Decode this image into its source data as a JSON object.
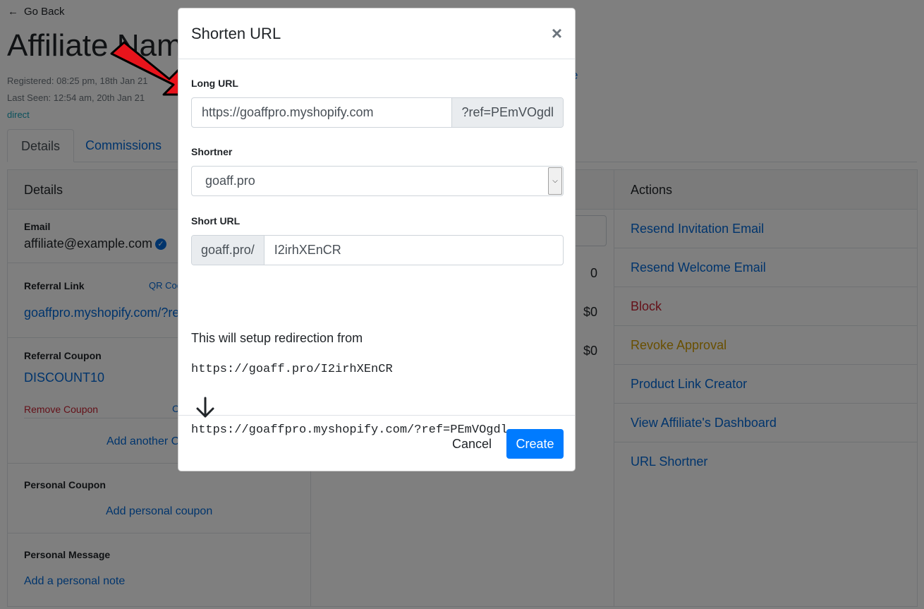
{
  "page": {
    "go_back": "Go Back",
    "title": "Affiliate Name",
    "registered": "Registered: 08:25 pm, 18th Jan 21",
    "last_seen": "Last Seen: 12:54 am, 20th Jan 21",
    "source": "direct",
    "edit_link": "e",
    "tabs": [
      {
        "label": "Details"
      },
      {
        "label": "Commissions"
      }
    ],
    "details_card": {
      "header": "Details",
      "email_label": "Email",
      "email_value": "affiliate@example.com",
      "referral_link_label": "Referral Link",
      "qr_code": "QR Code",
      "referral_link_value": "goaffpro.myshopify.com/?ref=PEmVOgdl",
      "referral_coupon_label": "Referral Coupon",
      "coupon_code": "DISCOUNT10",
      "remove_coupon": "Remove Coupon",
      "copy_label": "C",
      "add_another_coupon": "Add another Coupon",
      "personal_coupon_label": "Personal Coupon",
      "add_personal_coupon": "Add personal coupon",
      "personal_message_label": "Personal Message",
      "add_personal_note": "Add a personal note"
    },
    "stats_card": {
      "values": [
        "0",
        "$0",
        "$0"
      ]
    },
    "actions_card": {
      "header": "Actions",
      "items": [
        {
          "label": "Resend Invitation Email",
          "style": "blue"
        },
        {
          "label": "Resend Welcome Email",
          "style": "blue"
        },
        {
          "label": "Block",
          "style": "danger"
        },
        {
          "label": "Revoke Approval",
          "style": "warning"
        },
        {
          "label": "Product Link Creator",
          "style": "blue"
        },
        {
          "label": "View Affiliate's Dashboard",
          "style": "blue"
        },
        {
          "label": "URL Shortner",
          "style": "blue"
        }
      ]
    }
  },
  "modal": {
    "title": "Shorten URL",
    "close": "×",
    "long_url_label": "Long URL",
    "long_url_value": "https://goaffpro.myshopify.com",
    "long_url_suffix": "?ref=PEmVOgdl",
    "shortener_label": "Shortner",
    "shortener_value": "goaff.pro",
    "short_url_label": "Short URL",
    "short_url_prefix": "goaff.pro/",
    "short_url_value": "I2irhXEnCR",
    "info_text": "This will setup redirection from",
    "from_url": "https://goaff.pro/I2irhXEnCR",
    "to_url": "https://goaffpro.myshopify.com/?ref=PEmVOgdl",
    "cancel_label": "Cancel",
    "create_label": "Create"
  },
  "colors": {
    "primary": "#007bff",
    "link": "#0069d9",
    "danger": "#c82333",
    "warning": "#d39e00",
    "annotation_arrow": "#e8141c"
  }
}
